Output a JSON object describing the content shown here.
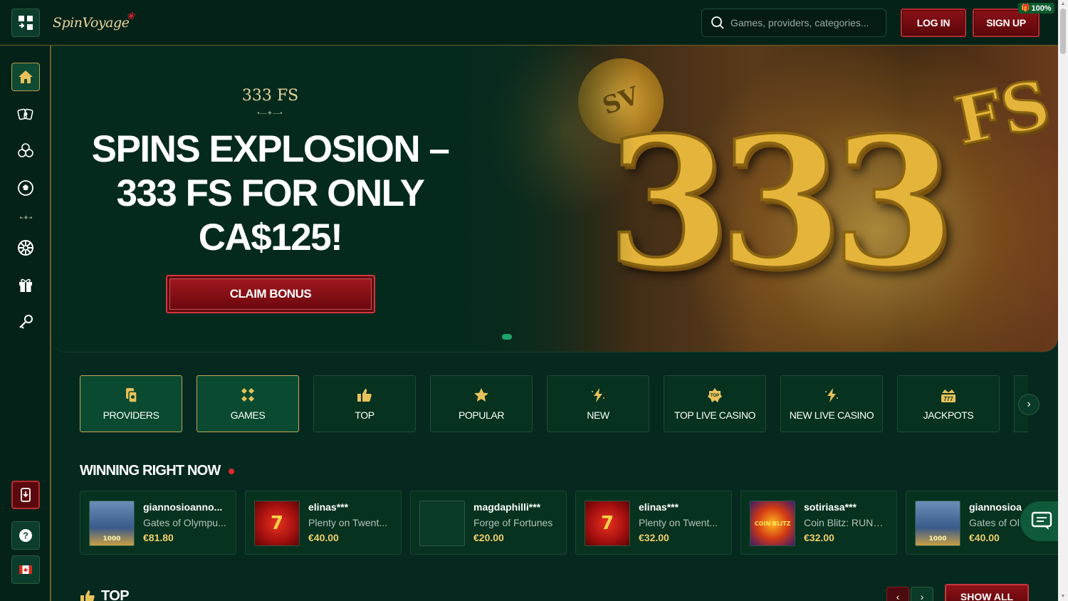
{
  "header": {
    "logo_text": "SpinVoyage",
    "search_placeholder": "Games, providers, categories...",
    "login_label": "LOG IN",
    "signup_label": "SIGN UP",
    "bonus_badge": "100%"
  },
  "sidebar": {
    "items": [
      {
        "name": "home",
        "icon": "home-icon"
      },
      {
        "name": "live-casino",
        "icon": "cards-icon"
      },
      {
        "name": "games",
        "icon": "chips-icon"
      },
      {
        "name": "sports",
        "icon": "soccer-ball-icon"
      },
      {
        "name": "wheel",
        "icon": "wheel-icon"
      },
      {
        "name": "promotions",
        "icon": "gift-icon"
      },
      {
        "name": "tournaments",
        "icon": "key-icon"
      }
    ],
    "bottom": [
      {
        "name": "install-app",
        "icon": "download-phone-icon"
      },
      {
        "name": "help",
        "icon": "help-icon"
      },
      {
        "name": "language",
        "icon": "canada-flag-icon"
      }
    ]
  },
  "hero": {
    "subtitle": "333 FS",
    "title": "SPINS EXPLOSION – 333 FS FOR ONLY CA$125!",
    "cta": "CLAIM BONUS",
    "art_number": "333",
    "art_suffix": "FS",
    "art_coin": "SV"
  },
  "categories": [
    {
      "label": "PROVIDERS",
      "icon": "providers-icon",
      "highlight": true
    },
    {
      "label": "GAMES",
      "icon": "games-icon",
      "highlight": true
    },
    {
      "label": "TOP",
      "icon": "thumbs-up-icon",
      "highlight": false
    },
    {
      "label": "POPULAR",
      "icon": "star-icon",
      "highlight": false
    },
    {
      "label": "NEW",
      "icon": "lightning-icon",
      "highlight": false
    },
    {
      "label": "TOP LIVE CASINO",
      "icon": "top-badge-icon",
      "highlight": false
    },
    {
      "label": "NEW LIVE CASINO",
      "icon": "lightning-icon",
      "highlight": false
    },
    {
      "label": "JACKPOTS",
      "icon": "jackpot-icon",
      "highlight": false
    }
  ],
  "winners": {
    "title": "WINNING RIGHT NOW",
    "items": [
      {
        "user": "giannosioanno...",
        "game": "Gates of Olympu...",
        "amount": "€81.80",
        "thumb": "olympus",
        "thumb_text": "1000"
      },
      {
        "user": "elinas***",
        "game": "Plenty on Twent...",
        "amount": "€40.00",
        "thumb": "twenty",
        "thumb_text": "7"
      },
      {
        "user": "magdaphilli***",
        "game": "Forge of Fortunes",
        "amount": "€20.00",
        "thumb": "forge",
        "thumb_text": ""
      },
      {
        "user": "elinas***",
        "game": "Plenty on Twent...",
        "amount": "€32.00",
        "thumb": "twenty",
        "thumb_text": "7"
      },
      {
        "user": "sotiriasa***",
        "game": "Coin Blitz: RUNNI...",
        "amount": "€32.00",
        "thumb": "coin",
        "thumb_text": "COIN BLITZ"
      },
      {
        "user": "giannosioa",
        "game": "Gates of Ol",
        "amount": "€40.00",
        "thumb": "olympus",
        "thumb_text": "1000"
      }
    ]
  },
  "top_section": {
    "title": "TOP",
    "show_all": "SHOW ALL"
  }
}
